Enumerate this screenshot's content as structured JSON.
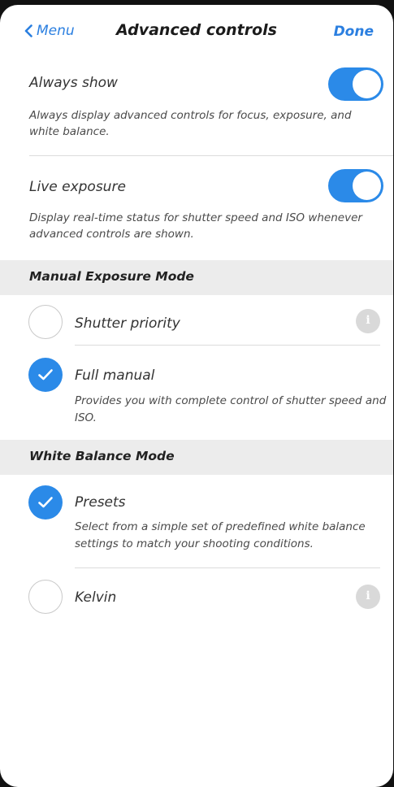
{
  "nav": {
    "back_label": "Menu",
    "title": "Advanced controls",
    "done_label": "Done"
  },
  "colors": {
    "accent": "#2b8ae8",
    "section_bg": "#ececec",
    "background": "#ffffff"
  },
  "toggles": [
    {
      "title": "Always show",
      "description": "Always display advanced controls for focus, exposure, and white balance.",
      "on": true
    },
    {
      "title": "Live exposure",
      "description": "Display real-time status for shutter speed and ISO whenever advanced controls are shown.",
      "on": true
    }
  ],
  "sections": [
    {
      "header": "Manual Exposure Mode",
      "options": [
        {
          "title": "Shutter priority",
          "selected": false,
          "info_icon": "info-icon"
        },
        {
          "title": "Full manual",
          "selected": true,
          "description": "Provides you with complete control of shutter speed and ISO."
        }
      ]
    },
    {
      "header": "White Balance Mode",
      "options": [
        {
          "title": "Presets",
          "selected": true,
          "description": "Select from a simple set of predefined white balance settings to match your shooting conditions."
        },
        {
          "title": "Kelvin",
          "selected": false,
          "info_icon": "info-icon"
        }
      ]
    }
  ],
  "icons": {
    "info_glyph": "i"
  }
}
